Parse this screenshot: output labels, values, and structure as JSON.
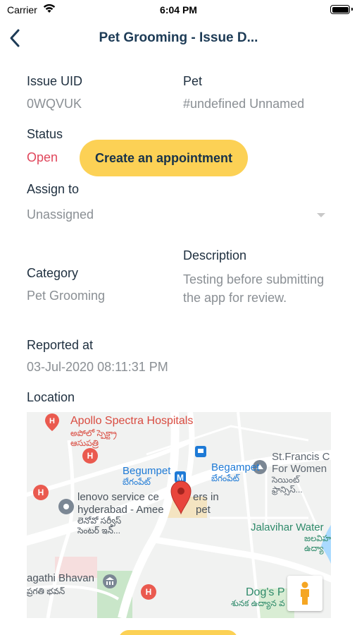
{
  "status_bar": {
    "carrier": "Carrier",
    "time": "6:04 PM"
  },
  "nav": {
    "title": "Pet Grooming - Issue D..."
  },
  "fields": {
    "issue_uid_label": "Issue UID",
    "issue_uid": "0WQVUK",
    "pet_label": "Pet",
    "pet": "#undefined Unnamed",
    "status_label": "Status",
    "status": "Open",
    "assign_label": "Assign to",
    "assign_value": "Unassigned",
    "description_label": "Description",
    "description": "Testing before submitting the app for review.",
    "category_label": "Category",
    "category": "Pet Grooming",
    "reported_label": "Reported at",
    "reported_at": "03-Jul-2020 08:11:31 PM",
    "location_label": "Location"
  },
  "actions": {
    "create_appointment": "Create an appointment"
  },
  "map": {
    "labels": {
      "apollo": "Apollo Spectra Hospitals",
      "apollo_te_1": "అపోలో స్పెక్ట్రా",
      "apollo_te_2": "ఆసుపత్రి",
      "begumpet_metro": "Begampet",
      "begumpet_metro_te": "బేగంపేట్",
      "begumpet": "Begumpet",
      "begumpet_te": "బేగంపేట్",
      "stfrancis_1": "St.Francis C",
      "stfrancis_2": "For Women",
      "stfrancis_te_1": "సెయింట్",
      "stfrancis_te_2": "ఫ్రాన్సిస్...",
      "lenovo_1": "lenovo service ce",
      "lenovo_1b": "ers in",
      "lenovo_2": "hyderabad - Amee",
      "lenovo_2b": "pet",
      "lenovo_te_1": "లెనోవో సర్వీస్",
      "lenovo_te_2": "సెంటర్ ఇన్...",
      "jalavihar": "Jalavihar Water",
      "jalavihar_te_1": "జలవిహ",
      "jalavihar_te_2": "ఉద్యా",
      "pragathi": "agathi Bhavan",
      "pragathi_te": "ప్రగతి భవన్",
      "dogs": "Dog's P",
      "dogs_te": "శునక ఉద్యాన వ"
    },
    "colors": {
      "road": "#ffffff",
      "water": "#aadaff",
      "park": "#c9e6c9",
      "pin": "#e8453c",
      "hospital": "#ea5a4f"
    }
  }
}
